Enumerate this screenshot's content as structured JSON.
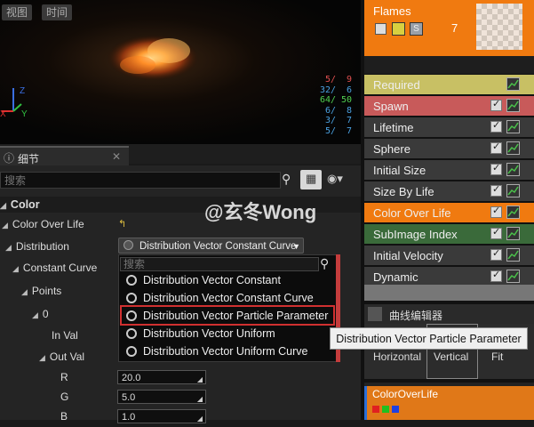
{
  "viewport": {
    "buttons": [
      "视图",
      "时间"
    ],
    "stats": [
      {
        "a": "5/",
        "b": "9",
        "ca": "#e05050",
        "cb": "#e05050"
      },
      {
        "a": "32/",
        "b": "6",
        "ca": "#4aa0e0",
        "cb": "#4aa0e0"
      },
      {
        "a": "64/",
        "b": "50",
        "ca": "#50d050",
        "cb": "#50d050"
      },
      {
        "a": "6/",
        "b": "8",
        "ca": "#4aa0e0",
        "cb": "#4aa0e0"
      },
      {
        "a": "3/",
        "b": "7",
        "ca": "#4aa0e0",
        "cb": "#4aa0e0"
      },
      {
        "a": "5/",
        "b": "7",
        "ca": "#4aa0e0",
        "cb": "#4aa0e0"
      }
    ]
  },
  "details": {
    "tab_label": "细节",
    "search_placeholder": "搜索",
    "category": "Color",
    "props": {
      "color_over_life": "Color Over Life",
      "distribution": "Distribution",
      "constant_curve": "Constant Curve",
      "points": "Points",
      "index0": "0",
      "in_val": "In Val",
      "out_val": "Out Val",
      "r": "R",
      "g": "G",
      "b": "B"
    },
    "values": {
      "r": "20.0",
      "g": "5.0",
      "b": "1.0"
    }
  },
  "dropdown": {
    "selected": "Distribution Vector Constant Curve",
    "search_placeholder": "搜索",
    "options": [
      "Distribution Vector Constant",
      "Distribution Vector Constant Curve",
      "Distribution Vector Particle Parameter",
      "Distribution Vector Uniform",
      "Distribution Vector Uniform Curve"
    ]
  },
  "tooltip": "Distribution Vector Particle Parameter",
  "emitter": {
    "name": "Flames",
    "count": "7",
    "modules": [
      {
        "label": "Required",
        "bg": "#c8c064",
        "check": false
      },
      {
        "label": "Spawn",
        "bg": "#c85a5a",
        "check": true
      },
      {
        "label": "Lifetime",
        "bg": "#3a3a3a",
        "check": true
      },
      {
        "label": "Sphere",
        "bg": "#3a3a3a",
        "check": true
      },
      {
        "label": "Initial Size",
        "bg": "#3a3a3a",
        "check": true
      },
      {
        "label": "Size By Life",
        "bg": "#3a3a3a",
        "check": true
      },
      {
        "label": "Color Over Life",
        "bg": "#f07a10",
        "check": true
      },
      {
        "label": "SubImage Index",
        "bg": "#3a6a3a",
        "check": true
      },
      {
        "label": "Initial Velocity",
        "bg": "#3a3a3a",
        "check": true
      },
      {
        "label": "Dynamic",
        "bg": "#3a3a3a",
        "check": true
      }
    ]
  },
  "curve_editor": {
    "tab_label": "曲线编辑器",
    "buttons": [
      "Horizontal",
      "Vertical",
      "Fit"
    ],
    "item_label": "ColorOverLife"
  },
  "watermark": "@玄冬Wong"
}
